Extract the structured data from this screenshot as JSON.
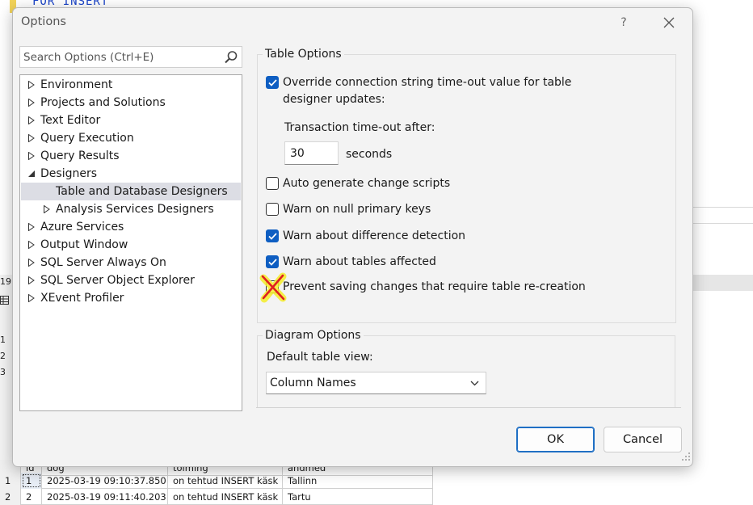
{
  "dialog": {
    "title": "Options",
    "help_label": "?",
    "search_placeholder": "Search Options (Ctrl+E)"
  },
  "tree": {
    "items": [
      {
        "label": "Environment",
        "expanded": false,
        "level": 0
      },
      {
        "label": "Projects and Solutions",
        "expanded": false,
        "level": 0
      },
      {
        "label": "Text Editor",
        "expanded": false,
        "level": 0
      },
      {
        "label": "Query Execution",
        "expanded": false,
        "level": 0
      },
      {
        "label": "Query Results",
        "expanded": false,
        "level": 0
      },
      {
        "label": "Designers",
        "expanded": true,
        "level": 0
      },
      {
        "label": "Table and Database Designers",
        "selected": true,
        "level": 1
      },
      {
        "label": "Analysis Services Designers",
        "expanded": false,
        "level": 1
      },
      {
        "label": "Azure Services",
        "expanded": false,
        "level": 0
      },
      {
        "label": "Output Window",
        "expanded": false,
        "level": 0
      },
      {
        "label": "SQL Server Always On",
        "expanded": false,
        "level": 0
      },
      {
        "label": "SQL Server Object Explorer",
        "expanded": false,
        "level": 0
      },
      {
        "label": "XEvent Profiler",
        "expanded": false,
        "level": 0
      }
    ]
  },
  "table_options": {
    "title": "Table Options",
    "override_timeout": {
      "line1": "Override connection string time-out value for table",
      "line2": "designer updates:",
      "checked": true
    },
    "timeout_label": "Transaction time-out after:",
    "timeout_value": "30",
    "timeout_unit": "seconds",
    "auto_generate": {
      "label": "Auto generate change scripts",
      "checked": false
    },
    "warn_null_pk": {
      "label": "Warn on null primary keys",
      "checked": false
    },
    "warn_difference": {
      "label": "Warn about difference detection",
      "checked": true
    },
    "warn_tables": {
      "label": "Warn about tables affected",
      "checked": true
    },
    "prevent_saving": {
      "label": "Prevent saving changes that require table re-creation",
      "checked": false
    }
  },
  "diagram_options": {
    "title": "Diagram Options",
    "default_view_label": "Default table view:",
    "default_view_value": "Column Names"
  },
  "buttons": {
    "ok": "OK",
    "cancel": "Cancel"
  },
  "background": {
    "code_text": "FOR INSERT",
    "side_numbers": [
      "19",
      "1",
      "2",
      "3"
    ],
    "grid_header": [
      "id",
      "dog",
      "toiming",
      "andmed"
    ],
    "grid_rows": [
      [
        "1",
        "1",
        "2025-03-19 09:10:37.850",
        "on tehtud INSERT käsk",
        "Tallinn"
      ],
      [
        "2",
        "2",
        "2025-03-19 09:11:40.203",
        "on tehtud INSERT käsk",
        "Tartu"
      ]
    ]
  },
  "colors": {
    "accent": "#0e5ec2",
    "dialog_bg": "#f3f3f3",
    "selection": "#dcdde4",
    "annotation_red": "#e02020",
    "annotation_yellow": "#f5ee2a"
  }
}
